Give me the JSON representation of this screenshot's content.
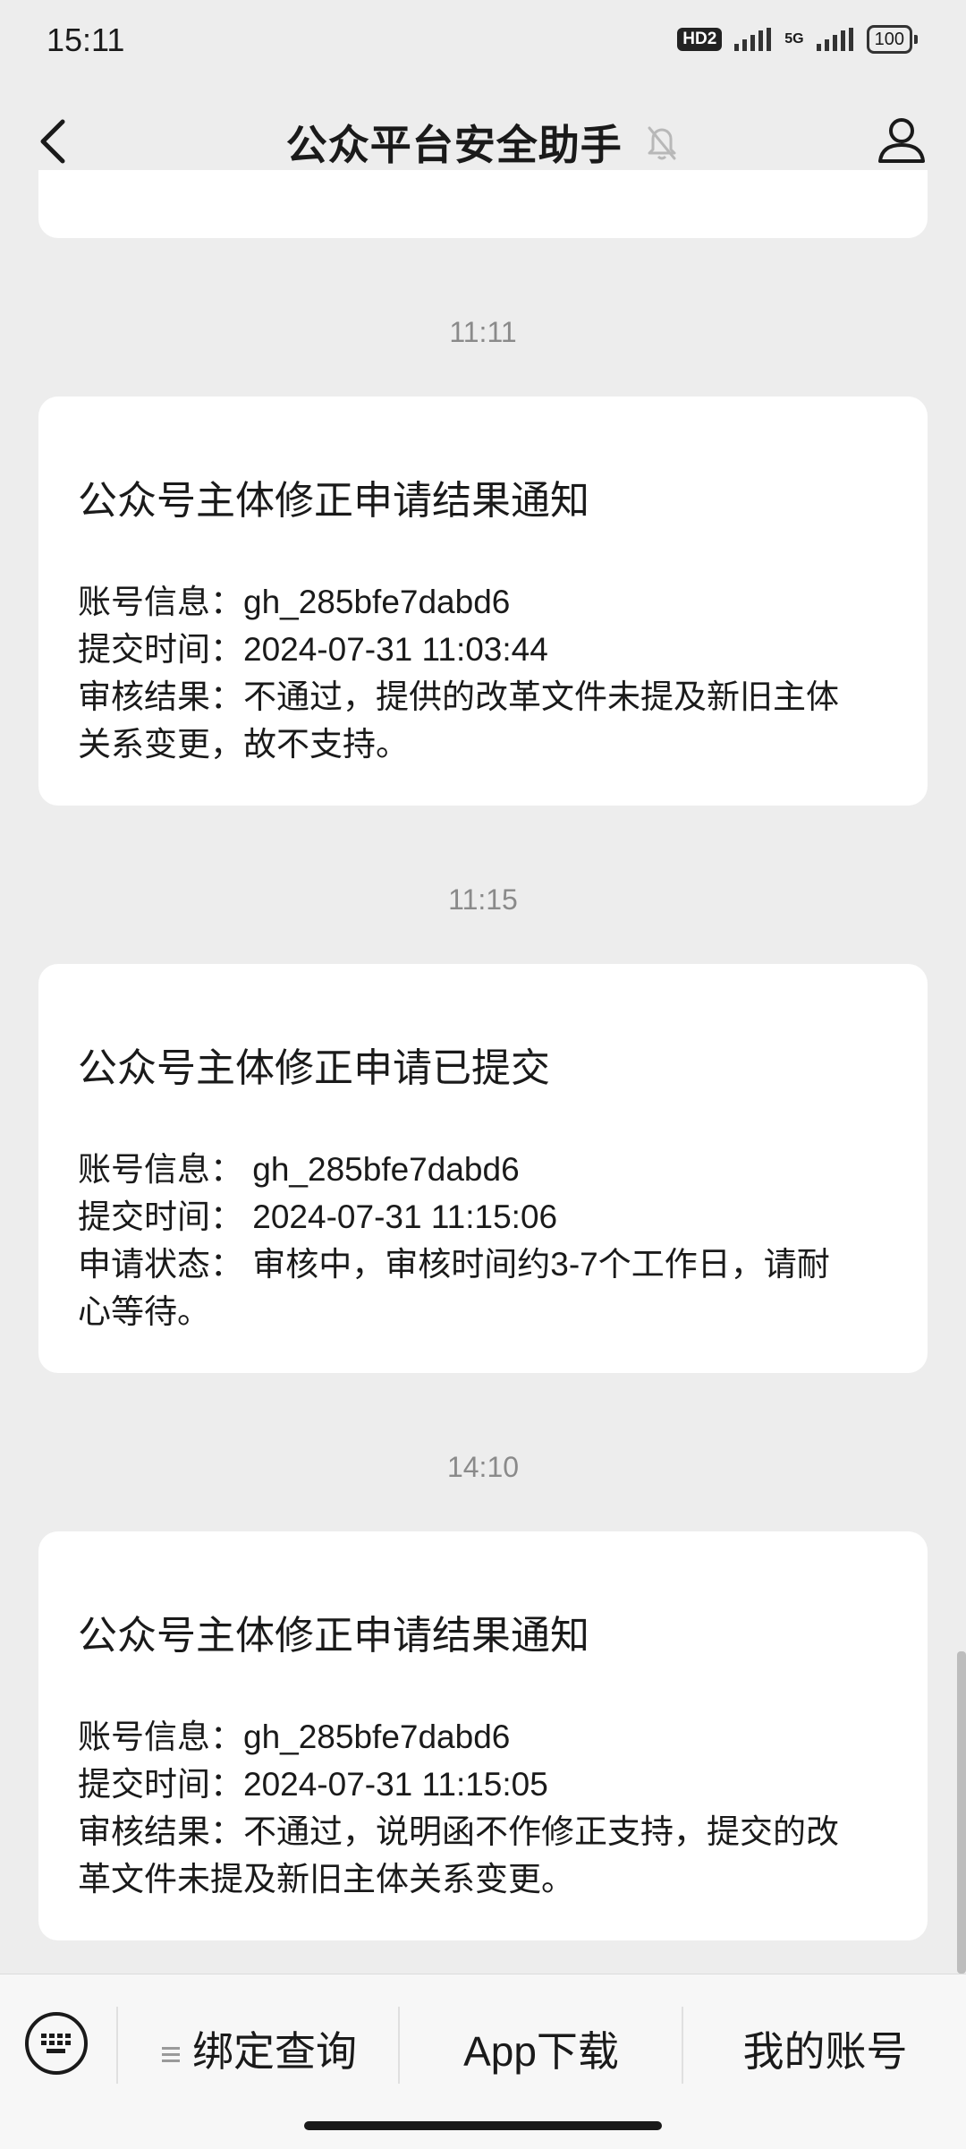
{
  "status_bar": {
    "time": "15:11",
    "hd": "HD2",
    "net": "5G",
    "battery": "100"
  },
  "nav": {
    "title": "公众平台安全助手",
    "icons": [
      "back-arrow-icon",
      "bell-muted-icon",
      "profile-icon"
    ]
  },
  "messages": [
    {
      "timestamp": "11:11",
      "title": "公众号主体修正申请结果通知",
      "rows": [
        "账号信息：gh_285bfe7dabd6",
        "提交时间：2024-07-31 11:03:44",
        "审核结果：不通过，提供的改革文件未提及新旧主体",
        "关系变更，故不支持。"
      ]
    },
    {
      "timestamp": "11:15",
      "title": "公众号主体修正申请已提交",
      "rows": [
        "账号信息：  gh_285bfe7dabd6",
        "提交时间：  2024-07-31 11:15:06",
        "申请状态：  审核中，审核时间约3-7个工作日，请耐",
        "心等待。"
      ]
    },
    {
      "timestamp": "14:10",
      "title": "公众号主体修正申请结果通知",
      "rows": [
        "账号信息：gh_285bfe7dabd6",
        "提交时间：2024-07-31 11:15:05",
        "审核结果：不通过，说明函不作修正支持，提交的改",
        "革文件未提及新旧主体关系变更。"
      ]
    }
  ],
  "menu": {
    "keyboard_icon": "keyboard-icon",
    "items": [
      "绑定查询",
      "App下载",
      "我的账号"
    ]
  }
}
